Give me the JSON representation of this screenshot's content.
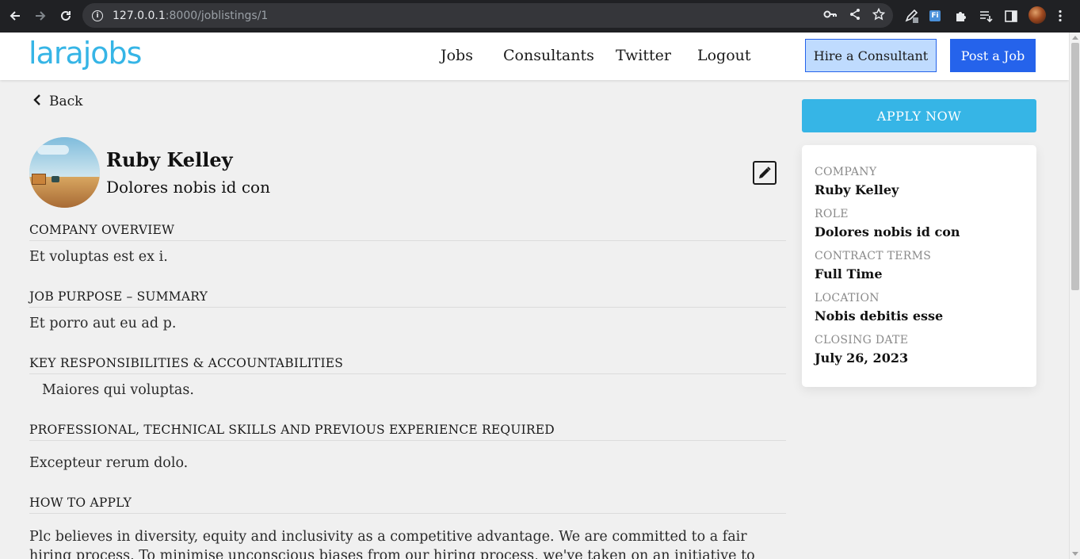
{
  "browser": {
    "url_host": "127.0.0.1",
    "url_path": ":8000/joblistings/1"
  },
  "site": {
    "logo": "larajobs",
    "nav": [
      "Jobs",
      "Consultants",
      "Twitter",
      "Logout"
    ],
    "hire_label": "Hire a Consultant",
    "post_label": "Post a Job"
  },
  "listing": {
    "back_label": "Back",
    "company": "Ruby Kelley",
    "role": "Dolores nobis id con",
    "sections": [
      {
        "heading": "COMPANY OVERVIEW",
        "body": "Et voluptas est ex i."
      },
      {
        "heading": "JOB PURPOSE – SUMMARY",
        "body": "Et porro aut eu ad p."
      },
      {
        "heading": "KEY RESPONSIBILITIES & ACCOUNTABILITIES",
        "body": "Maiores qui voluptas."
      },
      {
        "heading": "PROFESSIONAL, TECHNICAL SKILLS AND PREVIOUS EXPERIENCE REQUIRED",
        "body": "Excepteur rerum dolo."
      },
      {
        "heading": "HOW TO APPLY",
        "body": "Plc believes in diversity, equity and inclusivity as a competitive advantage. We are committed to a fair hiring process. To minimise unconscious biases from our hiring process, we've taken on an initiative to the"
      }
    ]
  },
  "sidebar": {
    "apply_label": "APPLY NOW",
    "details": [
      {
        "label": "COMPANY",
        "value": "Ruby Kelley"
      },
      {
        "label": "ROLE",
        "value": "Dolores nobis id con"
      },
      {
        "label": "CONTRACT TERMS",
        "value": "Full Time"
      },
      {
        "label": "LOCATION",
        "value": "Nobis debitis esse"
      },
      {
        "label": "CLOSING DATE",
        "value": "July 26, 2023"
      }
    ]
  },
  "colors": {
    "brand": "#36b5e6",
    "primary": "#2563eb",
    "hire_bg": "#bfdbfe",
    "page_bg": "#f0f0f0"
  },
  "icons": [
    "back-arrow-icon",
    "forward-arrow-icon",
    "reload-icon",
    "site-info-icon",
    "key-icon",
    "share-icon",
    "star-icon",
    "extension-pen-icon",
    "extension-fi-icon",
    "extensions-puzzle-icon",
    "reading-list-icon",
    "side-panel-icon",
    "profile-avatar",
    "menu-dots-icon",
    "chevron-left-icon",
    "edit-icon"
  ]
}
